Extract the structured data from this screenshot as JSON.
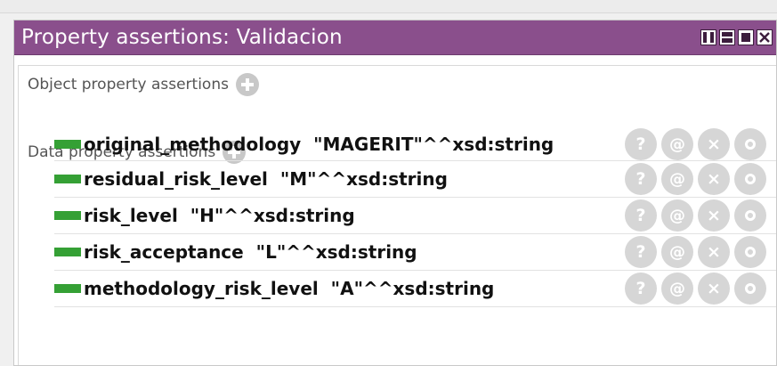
{
  "view": {
    "title": "Property assertions: Validacion"
  },
  "sections": {
    "object_properties_label": "Object property assertions",
    "data_properties_label": "Data property assertions"
  },
  "data_property_assertions": [
    {
      "text": "original_methodology  \"MAGERIT\"^^xsd:string"
    },
    {
      "text": "residual_risk_level  \"M\"^^xsd:string"
    },
    {
      "text": "risk_level  \"H\"^^xsd:string"
    },
    {
      "text": "risk_acceptance  \"L\"^^xsd:string"
    },
    {
      "text": "methodology_risk_level  \"A\"^^xsd:string"
    }
  ],
  "row_actions": {
    "explain_label": "?",
    "annotate_label": "@",
    "delete_label": "×"
  },
  "colors": {
    "titlebar": "#8a4f8c",
    "data_property_marker": "#35a035",
    "action_button": "#d6d6d6"
  },
  "icons": {
    "add": "add-icon",
    "explain": "question-icon",
    "annotate": "at-icon",
    "delete": "x-icon",
    "edit": "circle-icon"
  }
}
